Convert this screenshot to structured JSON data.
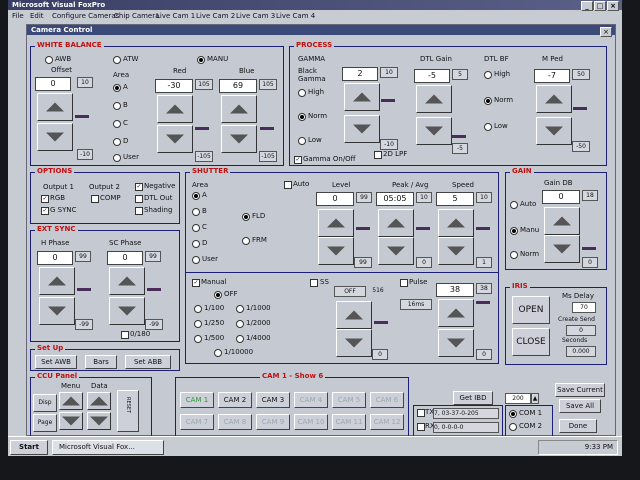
{
  "app_title": "Microsoft Visual FoxPro",
  "menu": [
    "File",
    "Edit",
    "Configure Cameras",
    "Chip Camera",
    "Live Cam 1",
    "Live Cam 2",
    "Live Cam 3",
    "Live Cam 4"
  ],
  "panel_title": "Camera Control",
  "white_balance": {
    "title": "WHITE BALANCE",
    "awb": "AWB",
    "atw": "ATW",
    "manu": "MANU",
    "offset_label": "Offset",
    "offset_value": "0",
    "offset_max": "10",
    "offset_min": "-10",
    "area_label": "Area",
    "area_options": [
      "A",
      "B",
      "C",
      "D",
      "User"
    ],
    "red_label": "Red",
    "red_value": "-30",
    "red_max": "105",
    "red_min": "-105",
    "blue_label": "Blue",
    "blue_value": "69",
    "blue_max": "105",
    "blue_min": "-105"
  },
  "process": {
    "title": "PROCESS",
    "gamma_label": "GAMMA",
    "black_gamma_label": "Black Gamma",
    "black_gamma_value": "2",
    "black_gamma_max": "10",
    "black_gamma_min": "-10",
    "gamma_options": [
      "High",
      "Norm",
      "Low"
    ],
    "lpf_label": "2D LPF",
    "gamma_onoff_label": "Gamma On/Off",
    "dtl_gain_label": "DTL Gain",
    "dtl_gain_value": "-5",
    "dtl_gain_max": "5",
    "dtl_gain_min": "-5",
    "dtl_bf_label": "DTL BF",
    "dtl_bf_options": [
      "High",
      "Norm",
      "Low"
    ],
    "mped_label": "M Ped",
    "mped_value": "-7",
    "mped_max": "50",
    "mped_min": "-50"
  },
  "options": {
    "title": "OPTIONS",
    "output1": "Output 1",
    "output2": "Output 2",
    "rgb": "RGB",
    "gsync": "G SYNC",
    "comp": "COMP",
    "negative": "Negative",
    "dtl_out": "DTL Out",
    "shading": "Shading"
  },
  "ext_sync": {
    "title": "EXT SYNC",
    "hphase_label": "H Phase",
    "hphase_value": "0",
    "hphase_max": "99",
    "hphase_min": "-99",
    "scphase_label": "SC Phase",
    "scphase_value": "0",
    "scphase_max": "99",
    "scphase_min": "-99",
    "range_label": "0/180"
  },
  "shutter": {
    "title": "SHUTTER",
    "area_label": "Area",
    "area_options": [
      "A",
      "B",
      "C",
      "D",
      "User"
    ],
    "fld": "FLD",
    "frm": "FRM",
    "auto_label": "Auto",
    "level_label": "Level",
    "level_value": "0",
    "level_max": "99",
    "level_min": "99",
    "peak_label": "Peak / Avg",
    "peak_value": "05:05",
    "peak_max": "10",
    "peak_min": "0",
    "speed_label": "Speed",
    "speed_value": "5",
    "speed_max": "10",
    "speed_min": "1",
    "manual_label": "Manual",
    "off_label": "OFF",
    "speeds": [
      "1/100",
      "1/1000",
      "1/250",
      "1/2000",
      "1/500",
      "1/4000",
      "1/10000"
    ],
    "ss_label": "SS",
    "ss_value": "OFF",
    "ss_max": "516",
    "ss_min": "0",
    "pulse_label": "Pulse",
    "pulse_unit": "16ms",
    "pulse_value": "38",
    "pulse_max": "38",
    "pulse_min": "0"
  },
  "gain": {
    "title": "GAIN",
    "gain_db_label": "Gain DB",
    "gain_value": "0",
    "gain_max": "18",
    "gain_min": "0",
    "options": [
      "Auto",
      "Manu",
      "Norm"
    ]
  },
  "iris": {
    "title": "IRIS",
    "open": "OPEN",
    "close": "CLOSE",
    "ms_delay_label": "Ms Delay",
    "ms_delay_value": "70",
    "create_send_label": "Create Send",
    "create_send_value": "0",
    "seconds_label": "Seconds",
    "seconds_value": "0.000"
  },
  "setup": {
    "title": "Set Up",
    "set_awb": "Set AWB",
    "bars": "Bars",
    "set_abb": "Set ABB"
  },
  "ccu": {
    "title": "CCU Panel",
    "menu_label": "Menu",
    "data_label": "Data",
    "disp": "Disp",
    "page": "Page",
    "reset": "RESET"
  },
  "cam_panel": {
    "title": "CAM 1 - Show 6",
    "row1": [
      "CAM 1",
      "CAM 2",
      "CAM 3",
      "CAM 4",
      "CAM 5",
      "CAM 6"
    ],
    "row2": [
      "CAM 7",
      "CAM 8",
      "CAM 9",
      "CAM 10",
      "CAM 11",
      "CAM 12"
    ]
  },
  "io": {
    "get_ibd": "Get IBD",
    "num_value": "200",
    "tx_label": "TX",
    "tx_value": "7, 03-37-0-205",
    "rx_label": "RX",
    "rx_value": "0, 0-0-0-0",
    "com1": "COM 1",
    "com2": "COM 2",
    "save_current": "Save Current",
    "save_all": "Save All",
    "done": "Done"
  },
  "taskbar": {
    "start": "Start",
    "task": "Microsoft Visual Fox...",
    "clock": "9:33 PM"
  }
}
